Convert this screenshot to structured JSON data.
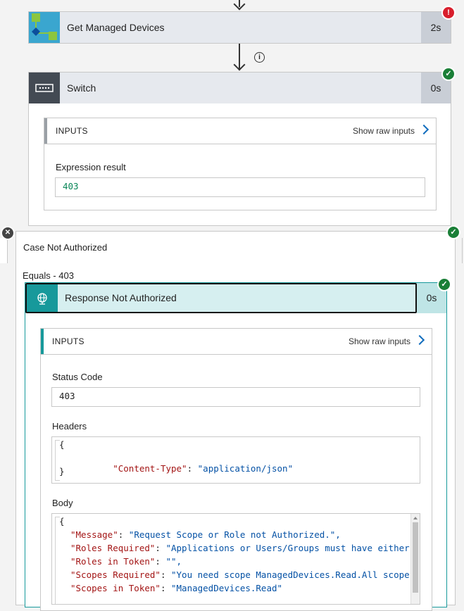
{
  "get_devices": {
    "title": "Get Managed Devices",
    "duration": "2s",
    "status_icon": "error-badge-icon"
  },
  "switch": {
    "title": "Switch",
    "duration": "0s",
    "inputs": {
      "heading": "INPUTS",
      "raw_label": "Show raw inputs",
      "field_label": "Expression result",
      "field_value": "403"
    }
  },
  "case": {
    "title": "Case Not Authorized",
    "condition": "Equals - 403"
  },
  "response": {
    "title": "Response Not Authorized",
    "duration": "0s",
    "inputs": {
      "heading": "INPUTS",
      "raw_label": "Show raw inputs",
      "status_label": "Status Code",
      "status_value": "403",
      "headers_label": "Headers",
      "headers": [
        {
          "text": "{"
        },
        {
          "key": "\"Content-Type\"",
          "sep": ": ",
          "val": "\"application/json\""
        },
        {
          "text": "}"
        }
      ],
      "body_label": "Body",
      "body": [
        {
          "text": "{"
        },
        {
          "key": "\"Message\"",
          "sep": ": ",
          "val": "\"Request Scope or Role not Authorized.\","
        },
        {
          "key": "\"Roles Required\"",
          "sep": ": ",
          "val": "\"Applications or Users/Groups must have either"
        },
        {
          "key": "\"Roles in Token\"",
          "sep": ": ",
          "val": "\"\","
        },
        {
          "key": "\"Scopes Required\"",
          "sep": ": ",
          "val": "\"You need scope ManagedDevices.Read.All scope"
        },
        {
          "key": "\"Scopes in Token\"",
          "sep": ": ",
          "val": "\"ManagedDevices.Read\""
        }
      ]
    }
  },
  "colors": {
    "accent_teal": "#17999b",
    "switch_icon_bg": "#434a53",
    "ok": "#1a7f37",
    "error": "#d81e2c",
    "link": "#0f6cbd"
  }
}
